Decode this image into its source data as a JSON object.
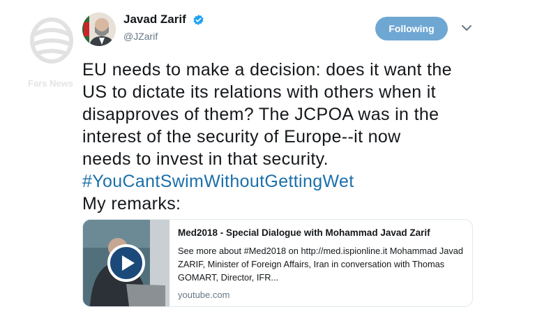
{
  "watermark": {
    "label": "Fars News"
  },
  "tweet": {
    "author": {
      "display_name": "Javad Zarif",
      "handle": "@JZarif",
      "verified": true
    },
    "follow_button": {
      "label": "Following"
    },
    "menu_icon": "chevron-down-icon",
    "text_lines": [
      "EU needs to make a decision: does it want the",
      "US to dictate its relations with others when it",
      "disapproves of them? The JCPOA was in the",
      "interest of the security of Europe--it now",
      "needs to invest in that security."
    ],
    "hashtag": "#YouCantSwimWithoutGettingWet",
    "remarks": "My remarks:",
    "card": {
      "title": "Med2018 - Special Dialogue with Mohammad Javad Zarif",
      "description": "See more about #Med2018 on http://med.ispionline.it Mohammad Javad ZARIF, Minister of Foreign Affairs, Iran in conversation with Thomas GOMART, Director, IFR...",
      "domain": "youtube.com",
      "media_icon": "play-icon"
    }
  },
  "colors": {
    "follow_button": "#6fa7d3",
    "hashtag": "#1b6faa",
    "verified": "#1da1f2",
    "secondary_text": "#657786"
  }
}
